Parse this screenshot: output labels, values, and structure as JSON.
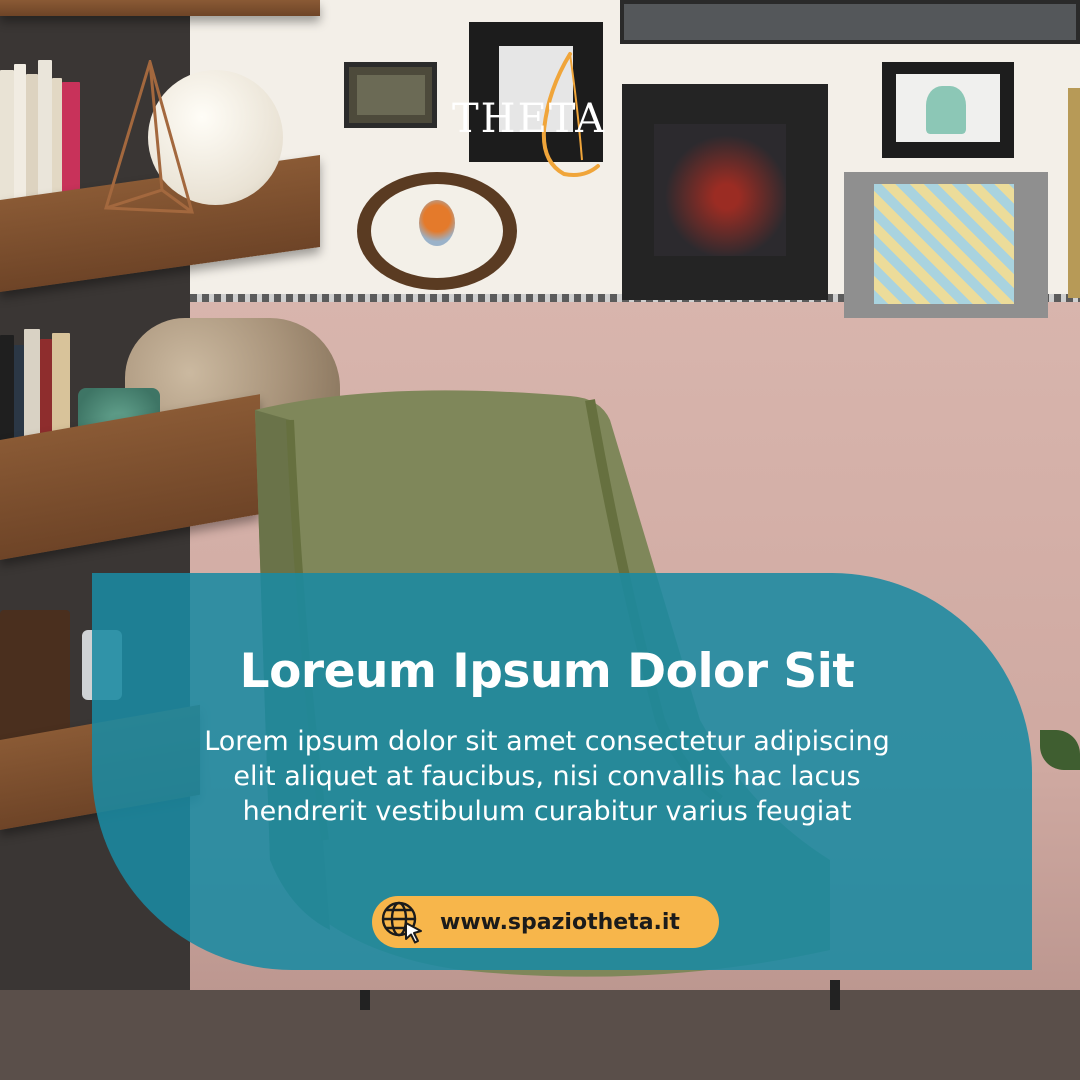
{
  "brand": {
    "logo_text": "THETA"
  },
  "headline": "Loreum Ipsum Dolor Sit",
  "body_lines": [
    "Lorem ipsum dolor sit amet consectetur adipiscing",
    "elit aliquet at faucibus, nisi convallis hac lacus",
    "hendrerit vestibulum curabitur varius feugiat"
  ],
  "cta": {
    "url": "www.spaziotheta.it",
    "icon": "globe-cursor-icon"
  },
  "colors": {
    "panel": "#1a8aa2",
    "pill": "#f7b64b",
    "text": "#ffffff",
    "logo_accent": "#f0a53a"
  }
}
